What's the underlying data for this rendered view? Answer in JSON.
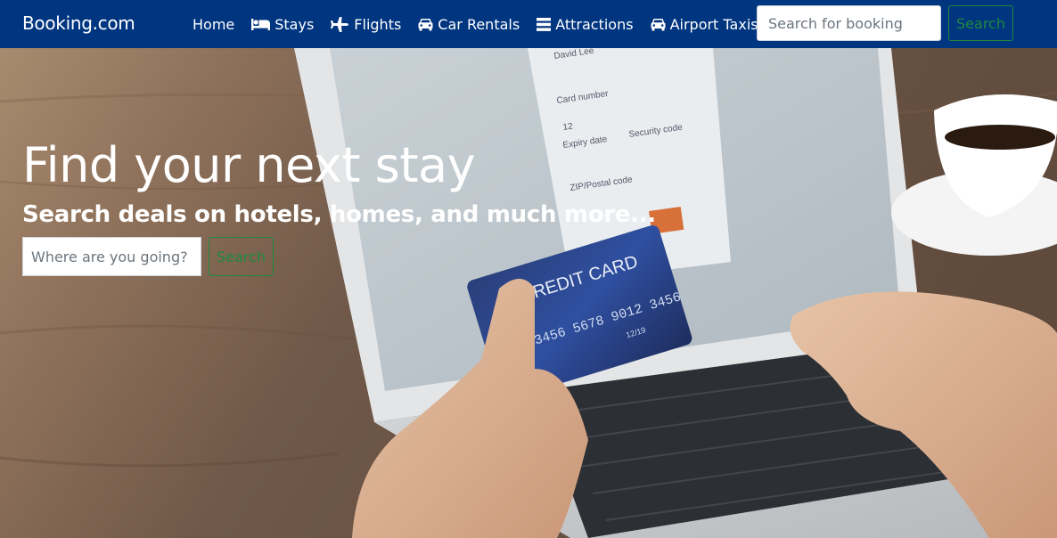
{
  "navbar": {
    "brand": "Booking.com",
    "links": [
      {
        "label": "Home",
        "icon": "none"
      },
      {
        "label": "Stays",
        "icon": "bed-icon"
      },
      {
        "label": "Flights",
        "icon": "plane-icon"
      },
      {
        "label": "Car Rentals",
        "icon": "car-icon"
      },
      {
        "label": "Attractions",
        "icon": "list-icon"
      },
      {
        "label": "Airport Taxis",
        "icon": "taxi-icon"
      }
    ],
    "search_placeholder": "Search for booking",
    "search_button": "Search"
  },
  "hero": {
    "title": "Find your next stay",
    "subtitle": "Search deals on hotels, homes, and much more...",
    "destination_placeholder": "Where are you going?",
    "search_button": "Search",
    "image": {
      "card_text": "CREDIT CARD",
      "card_number": "3456 5678 9012 3456",
      "card_date": "12/19",
      "form_name": "David Lee",
      "form_card_number_label": "Card number",
      "form_expiry_label": "Expiry date",
      "form_expiry_value": "12",
      "form_security_label": "Security code",
      "form_zip_label": "ZIP/Postal code"
    }
  },
  "colors": {
    "navbar_bg": "#003580",
    "accent_green": "#1e8a3e"
  }
}
